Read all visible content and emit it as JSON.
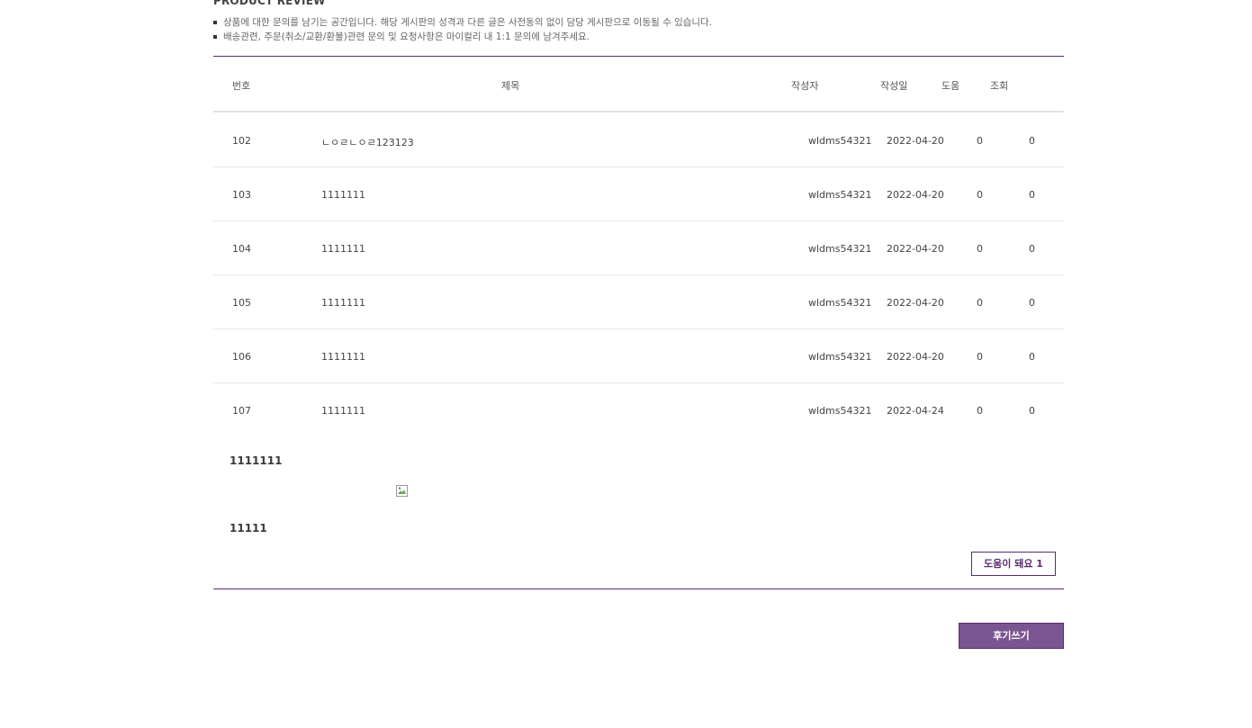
{
  "board": {
    "title": "PRODUCT REVIEW",
    "notices": [
      "상품에 대한 문의를 남기는 공간입니다. 해당 게시판의 성격과 다른 글은 사전동의 없이 담당 게시판으로 이동될 수 있습니다.",
      "배송관련, 주문(취소/교환/환불)관련 문의 및 요청사항은 마이컬리 내 1:1 문의에 남겨주세요."
    ],
    "accent_color": "#5b2c6f",
    "button_fill_color": "#7b5592"
  },
  "table": {
    "headers": {
      "no": "번호",
      "subject": "제목",
      "writer": "작성자",
      "date": "작성일",
      "help": "도움",
      "hits": "조회"
    },
    "rows": [
      {
        "no": "102",
        "subject": "ㄴㅇㄹㄴㅇㄹ123123",
        "writer": "wldms54321",
        "date": "2022-04-20",
        "help": "0",
        "hits": "0"
      },
      {
        "no": "103",
        "subject": "1111111",
        "writer": "wldms54321",
        "date": "2022-04-20",
        "help": "0",
        "hits": "0"
      },
      {
        "no": "104",
        "subject": "1111111",
        "writer": "wldms54321",
        "date": "2022-04-20",
        "help": "0",
        "hits": "0"
      },
      {
        "no": "105",
        "subject": "1111111",
        "writer": "wldms54321",
        "date": "2022-04-20",
        "help": "0",
        "hits": "0"
      },
      {
        "no": "106",
        "subject": "1111111",
        "writer": "wldms54321",
        "date": "2022-04-20",
        "help": "0",
        "hits": "0"
      },
      {
        "no": "107",
        "subject": "1111111",
        "writer": "wldms54321",
        "date": "2022-04-24",
        "help": "0",
        "hits": "0"
      }
    ]
  },
  "detail": {
    "title": "1111111",
    "image_icon": "broken-image-icon",
    "body": "11111",
    "help_button_label": "도움이 돼요 1"
  },
  "actions": {
    "write_review_label": "후기쓰기"
  }
}
